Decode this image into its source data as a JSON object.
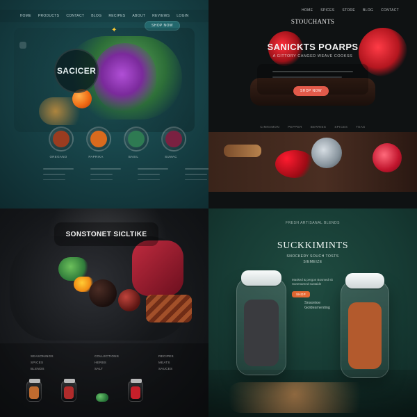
{
  "quadrants": {
    "q1": {
      "nav": [
        "HOME",
        "PRODUCTS",
        "CONTACT",
        "BLOG",
        "RECIPES",
        "ABOUT",
        "REVIEWS",
        "LOGIN"
      ],
      "cta": "SHOP NOW",
      "title": "SACICER",
      "jar_fills": [
        "#9a3c20",
        "#d96a1d",
        "#2e7a52",
        "#7a2141"
      ],
      "jar_labels": [
        "OREGANO",
        "PAPRIKA",
        "BASIL",
        "SUMAC"
      ]
    },
    "q2": {
      "nav": [
        "HOME",
        "SPICES",
        "STORE",
        "BLOG",
        "CONTACT"
      ],
      "brand": "STOUCHANTS",
      "title": "SANICKTS POARPS",
      "subtitle": "A GITTORY CANGED WEAVE COOKSS",
      "cta": "SHOP NOW",
      "divider": [
        "CINNAMON",
        "PEPPER",
        "BERRIES",
        "SPICES",
        "TEAS"
      ]
    },
    "q3": {
      "title": "SONSTONET SICLTIKE",
      "columns": [
        {
          "heading": "SEASONINGS",
          "lines": [
            "SPICES",
            "BLENDS"
          ]
        },
        {
          "heading": "COLLECTIONS",
          "lines": [
            "HERBS",
            "SALT"
          ]
        },
        {
          "heading": "RECIPES",
          "lines": [
            "MEATS",
            "SAUCES"
          ]
        }
      ],
      "jar_fills": [
        "#c06b2f",
        "#b12b2b",
        "#5bb35c",
        "#c61f2a"
      ]
    },
    "q4": {
      "kicker": "FRESH ARTISANAL BLENDS",
      "title": "SUCKKIMINTS",
      "subtitle_1": "SNOCKERY SOUCH TOSTS",
      "subtitle_2": "SIEMEIZE",
      "info_text": "Masked & pergon Bosmed sit Sunenamed sustaide",
      "info_button": "SHOP",
      "info2_line_1": "Snsontoe",
      "info2_line_2": "Goldesmenting",
      "jar_fills": [
        "#3a3b3f",
        "#b35a2d"
      ]
    }
  }
}
